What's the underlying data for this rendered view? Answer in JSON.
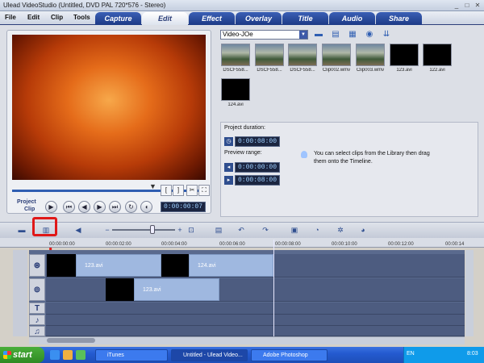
{
  "window": {
    "title": "Ulead VideoStudio (Untitled, DVD PAL 720*576 - Stereo)",
    "controls": [
      "minimize",
      "maximize",
      "close"
    ]
  },
  "menu": [
    "File",
    "Edit",
    "Clip",
    "Tools"
  ],
  "tabs": [
    {
      "label": "Capture",
      "active": false
    },
    {
      "label": "Edit",
      "active": true
    },
    {
      "label": "Effect",
      "active": false
    },
    {
      "label": "Overlay",
      "active": false
    },
    {
      "label": "Title",
      "active": false
    },
    {
      "label": "Audio",
      "active": false
    },
    {
      "label": "Share",
      "active": false
    }
  ],
  "player": {
    "mode_project": "Project",
    "mode_clip": "Clip",
    "timecode": "0:00:00:07",
    "trim_in": "[",
    "trim_out": "]"
  },
  "library": {
    "selected_folder": "Video-JOe",
    "thumbnails": [
      {
        "label": "DSCF558...",
        "kind": "photo"
      },
      {
        "label": "DSCF558...",
        "kind": "photo"
      },
      {
        "label": "DSCF558...",
        "kind": "photo"
      },
      {
        "label": "Clip002.wmv",
        "kind": "photo"
      },
      {
        "label": "Clip003.wmv",
        "kind": "photo"
      },
      {
        "label": "123.avi",
        "kind": "black"
      },
      {
        "label": "122.avi",
        "kind": "black"
      },
      {
        "label": "124.avi",
        "kind": "black"
      }
    ]
  },
  "info": {
    "project_duration_label": "Project duration:",
    "project_duration": "0:00:08:00",
    "preview_range_label": "Preview range:",
    "preview_start": "0:00:00:00",
    "preview_end": "0:00:08:00",
    "tip": "You can select clips from the Library then drag them onto the Timeline."
  },
  "annotation": {
    "number": "1"
  },
  "ruler": [
    "00:00:00:00",
    "00:00:02:00",
    "00:00:04:00",
    "00:00:06:00",
    "00:00:08:00",
    "00:00:10:00",
    "00:00:12:00",
    "00:00:14"
  ],
  "timeline": {
    "video_track_clips": [
      "123.avi",
      "124.avi"
    ],
    "overlay_track_clips": [
      "123.avi"
    ],
    "track_icons": [
      "film-icon",
      "overlay-icon",
      "title-icon",
      "voice-icon",
      "music-icon"
    ]
  },
  "taskbar": {
    "start": "start",
    "tasks": [
      {
        "label": "iTunes",
        "active": false
      },
      {
        "label": "Untitled - Ulead Video...",
        "active": true
      },
      {
        "label": "Adobe Photoshop",
        "active": false
      }
    ],
    "language": "EN",
    "clock": "8:03"
  },
  "colors": {
    "tab_blue": "#1d3a85",
    "annotation_red": "#e01818",
    "timeline_bg": "#5a6a8e",
    "taskbar_blue": "#245ad0"
  }
}
